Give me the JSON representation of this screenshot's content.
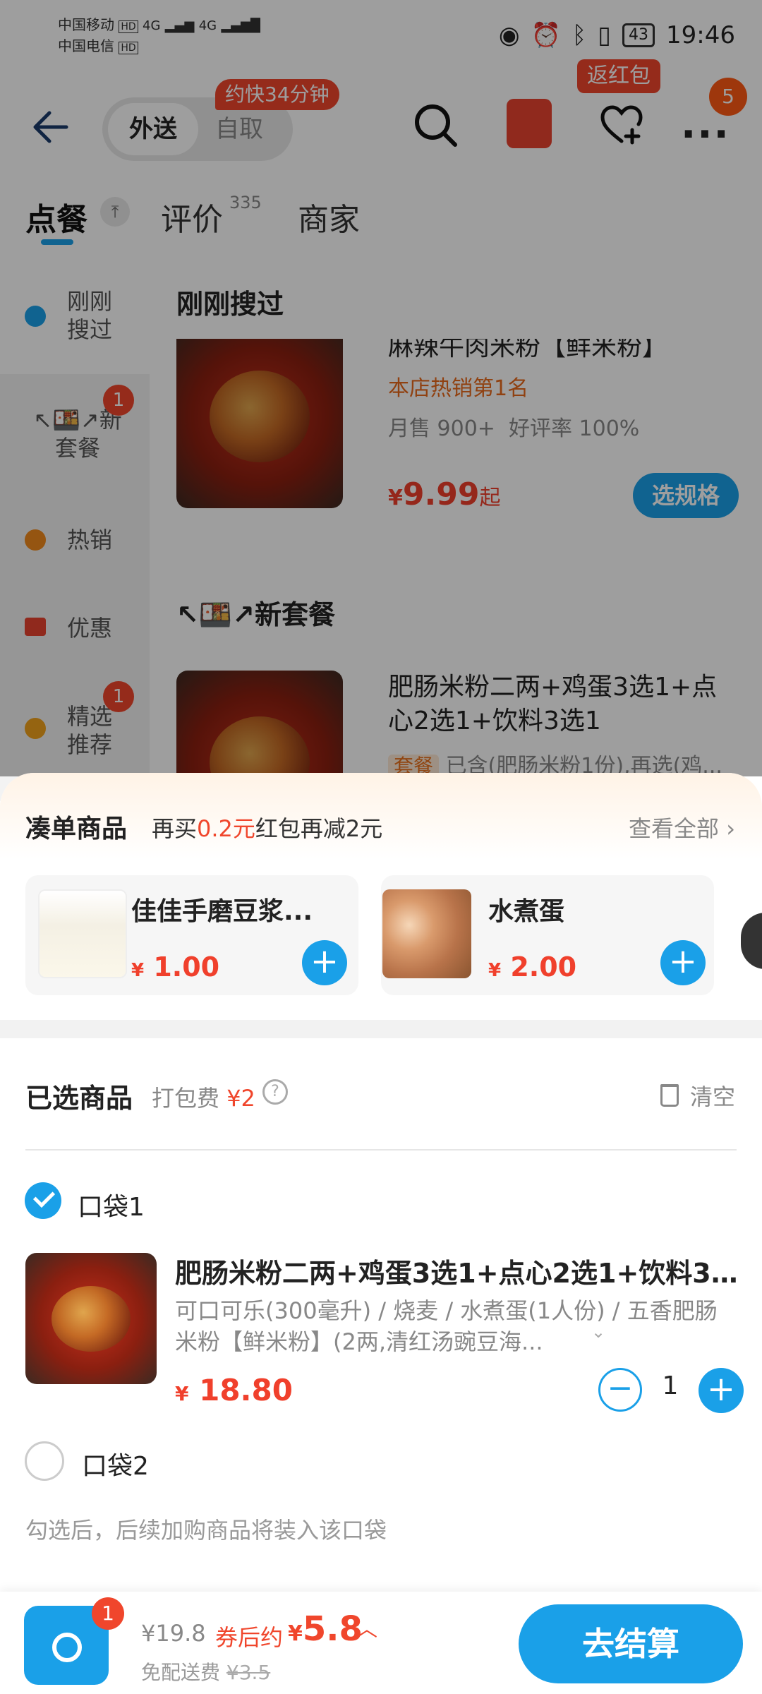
{
  "status_bar": {
    "carrier1": "中国移动",
    "carrier2": "中国电信",
    "hd": "HD",
    "net1": "4G",
    "net2": "4G",
    "battery": "43",
    "time": "19:46"
  },
  "topbar": {
    "mode_delivery": "外送",
    "mode_pickup": "自取",
    "eta_badge": "约快34分钟",
    "cashback_badge": "返红包",
    "more_badge": "5"
  },
  "tabs": {
    "order": "点餐",
    "reviews": "评价",
    "reviews_count": "335",
    "merchant": "商家"
  },
  "sidebar": {
    "items": [
      {
        "label_line1": "刚刚",
        "label_line2": "搜过"
      },
      {
        "label_line1": "↖🍱↗新",
        "label_line2": "套餐",
        "badge": "1"
      },
      {
        "label_line1": "热销"
      },
      {
        "label_line1": "优惠"
      },
      {
        "label_line1": "精选",
        "label_line2": "推荐",
        "badge": "1"
      }
    ]
  },
  "menu": {
    "section1": "刚刚搜过",
    "item1": {
      "name": "麻辣牛肉米粉【鲜米粉】",
      "rank": "本店热销第1名",
      "sales": "月售 900+",
      "rating": "好评率 100%",
      "price": "9.99",
      "price_suffix": "起",
      "currency": "¥",
      "spec_button": "选规格"
    },
    "section2": "↖🍱↗新套餐",
    "item2": {
      "name": "肥肠米粉二两+鸡蛋3选1+点心2选1+饮料3选1",
      "tag": "套餐",
      "desc": "已含(肥肠米粉1份),再选(鸡..."
    }
  },
  "addon": {
    "title": "凑单商品",
    "sub_prefix": "再买",
    "sub_amount": "0.2元",
    "sub_suffix": "红包再减2元",
    "view_all": "查看全部",
    "items": [
      {
        "name": "佳佳手磨豆浆...",
        "currency": "¥",
        "price": "1.00"
      },
      {
        "name": "水煮蛋",
        "currency": "¥",
        "price": "2.00"
      }
    ]
  },
  "selected": {
    "title": "已选商品",
    "pack_fee_label": "打包费",
    "pack_fee": "¥2",
    "clear": "清空",
    "bag1": "口袋1",
    "bag2": "口袋2",
    "bag_hint": "勾选后，后续加购商品将装入该口袋",
    "item": {
      "name": "肥肠米粉二两+鸡蛋3选1+点心2选1+饮料3...",
      "spec": "可口可乐(300毫升) / 烧麦 / 水煮蛋(1人份) / 五香肥肠米粉【鲜米粉】(2两,清红汤豌豆海...",
      "currency": "¥",
      "price": "18.80",
      "quantity": "1"
    }
  },
  "checkout": {
    "cart_count": "1",
    "original_total": "¥19.8",
    "after_label": "券后约",
    "currency": "¥",
    "final_price": "5.8",
    "free_delivery": "免配送费",
    "delivery_original": "¥3.5",
    "button": "去结算"
  },
  "colors": {
    "accent": "#1aa0e8",
    "price_red": "#f0402c",
    "badge_orange": "#ff5a14"
  }
}
